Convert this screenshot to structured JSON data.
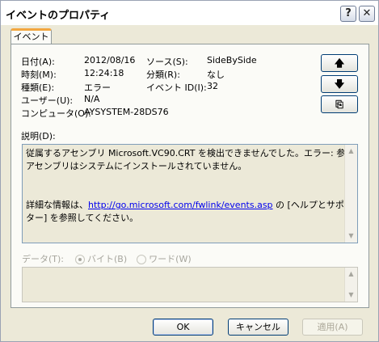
{
  "window": {
    "title": "イベントのプロパティ",
    "help_glyph": "?",
    "close_glyph": "✕"
  },
  "tab": {
    "label": "イベント"
  },
  "fields": {
    "date_label": "日付(A):",
    "date_value": "2012/08/16",
    "time_label": "時刻(M):",
    "time_value": "12:24:18",
    "type_label": "種類(E):",
    "type_value": "エラー",
    "user_label": "ユーザー(U):",
    "user_value": "N/A",
    "computer_label": "コンピュータ(O):",
    "computer_value": "AYSYSTEM-28DS76",
    "source_label": "ソース(S):",
    "source_value": "SideBySide",
    "category_label": "分類(R):",
    "category_value": "なし",
    "eventid_label": "イベント ID(I):",
    "eventid_value": "32"
  },
  "nav": {
    "up_glyph": "🡅",
    "down_glyph": "🡇",
    "copy_glyph": "⎘"
  },
  "description": {
    "label": "説明(D):",
    "line1": "従属するアセンブリ Microsoft.VC90.CRT を検出できませんでした。エラー: 参照された",
    "line2": "アセンブリはシステムにインストールされていません。",
    "line3_prefix": "詳細な情報は、",
    "link": "http://go.microsoft.com/fwlink/events.asp",
    "line3_suffix": " の [ヘルプとサポート セン",
    "line4": "ター] を参照してください。"
  },
  "data": {
    "label": "データ(T):",
    "bytes_label": "バイト(B)",
    "words_label": "ワード(W)"
  },
  "buttons": {
    "ok": "OK",
    "cancel": "キャンセル",
    "apply": "適用(A)"
  }
}
